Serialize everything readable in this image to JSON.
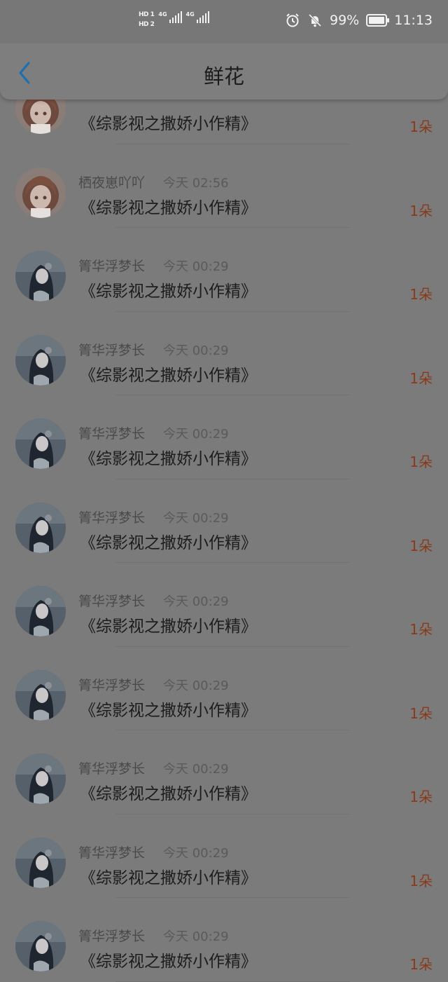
{
  "status_bar": {
    "sim1": "HD 1",
    "sim2": "HD 2",
    "net1": "4G",
    "net2": "4G",
    "battery": "99%",
    "time": "11:13"
  },
  "header": {
    "title": "鲜花",
    "back_icon": "chevron-left-icon"
  },
  "colors": {
    "accent": "#1e6fb0",
    "count": "#8a3a1a"
  },
  "gifts": [
    {
      "user": "",
      "time": "",
      "book": "《综影视之撒娇小作精》",
      "count": "1朵",
      "avatar": "anime-girl-brown-hair"
    },
    {
      "user": "栖夜崽吖吖",
      "time": "今天 02:56",
      "book": "《综影视之撒娇小作精》",
      "count": "1朵",
      "avatar": "anime-girl-brown-hair"
    },
    {
      "user": "箐华浮梦长",
      "time": "今天 00:29",
      "book": "《综影视之撒娇小作精》",
      "count": "1朵",
      "avatar": "dark-hair-girl"
    },
    {
      "user": "箐华浮梦长",
      "time": "今天 00:29",
      "book": "《综影视之撒娇小作精》",
      "count": "1朵",
      "avatar": "dark-hair-girl"
    },
    {
      "user": "箐华浮梦长",
      "time": "今天 00:29",
      "book": "《综影视之撒娇小作精》",
      "count": "1朵",
      "avatar": "dark-hair-girl"
    },
    {
      "user": "箐华浮梦长",
      "time": "今天 00:29",
      "book": "《综影视之撒娇小作精》",
      "count": "1朵",
      "avatar": "dark-hair-girl"
    },
    {
      "user": "箐华浮梦长",
      "time": "今天 00:29",
      "book": "《综影视之撒娇小作精》",
      "count": "1朵",
      "avatar": "dark-hair-girl"
    },
    {
      "user": "箐华浮梦长",
      "time": "今天 00:29",
      "book": "《综影视之撒娇小作精》",
      "count": "1朵",
      "avatar": "dark-hair-girl"
    },
    {
      "user": "箐华浮梦长",
      "time": "今天 00:29",
      "book": "《综影视之撒娇小作精》",
      "count": "1朵",
      "avatar": "dark-hair-girl"
    },
    {
      "user": "箐华浮梦长",
      "time": "今天 00:29",
      "book": "《综影视之撒娇小作精》",
      "count": "1朵",
      "avatar": "dark-hair-girl"
    },
    {
      "user": "箐华浮梦长",
      "time": "今天 00:29",
      "book": "《综影视之撒娇小作精》",
      "count": "1朵",
      "avatar": "dark-hair-girl"
    }
  ]
}
